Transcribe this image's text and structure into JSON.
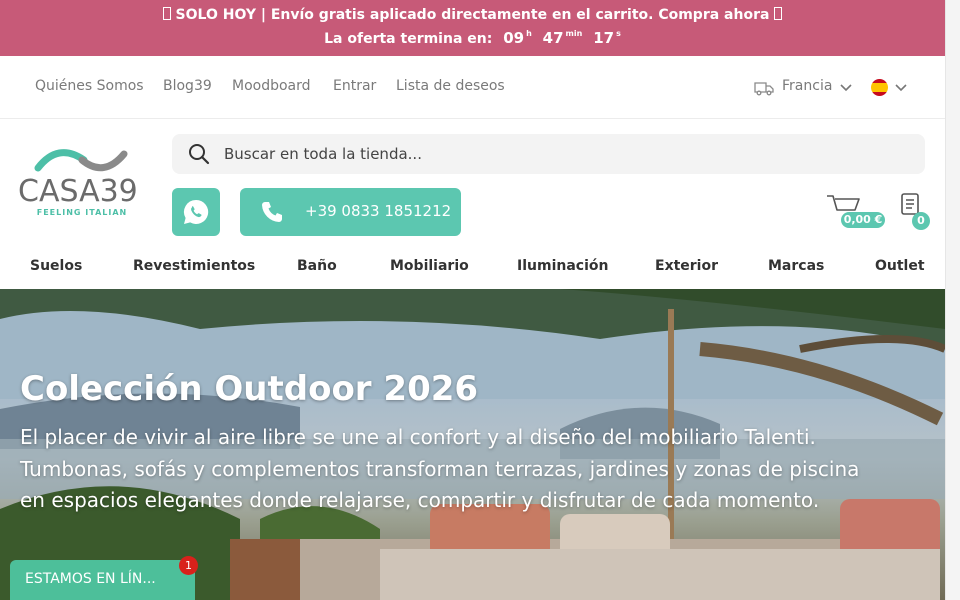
{
  "promo": {
    "text": "SOLO HOY | Envío gratis aplicado directamente en el carrito. Compra ahora",
    "countdown_label": "La oferta termina en:",
    "hours": "09",
    "hours_unit": "h",
    "minutes": "47",
    "minutes_unit": "min",
    "seconds": "17",
    "seconds_unit": "s",
    "bg_color": "#c75a78"
  },
  "topnav": {
    "links": [
      "Quiénes Somos",
      "Blog39",
      "Moodboard",
      "Entrar",
      "Lista de deseos"
    ],
    "country": "Francia",
    "language_flag": "es-flag-icon"
  },
  "logo": {
    "name": "CASA39",
    "tagline": "FEELING ITALIAN"
  },
  "search": {
    "placeholder": "Buscar en toda la tienda..."
  },
  "contact": {
    "whatsapp_icon": "whatsapp-icon",
    "phone": "+39 0833 1851212",
    "accent_color": "#5cc7b0"
  },
  "cart": {
    "total": "0,00 €",
    "list_count": "0"
  },
  "categories": [
    "Suelos",
    "Revestimientos",
    "Baño",
    "Mobiliario",
    "Iluminación",
    "Exterior",
    "Marcas",
    "Outlet"
  ],
  "hero": {
    "title": "Colección Outdoor 2026",
    "lines": [
      "El placer de vivir al aire libre se une al confort y al diseño del mobiliario Talenti.",
      "Tumbonas, sofás y complementos transforman terrazas, jardines y zonas de piscina",
      "en espacios elegantes donde relajarse, compartir y disfrutar de cada momento."
    ]
  },
  "chat": {
    "label": "ESTAMOS EN LÍN...",
    "badge": "1"
  }
}
